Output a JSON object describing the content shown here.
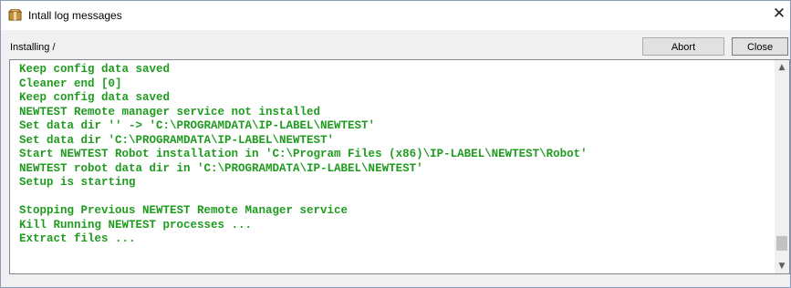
{
  "window": {
    "title": "Intall log messages",
    "icon": "installer-box-icon",
    "close_glyph": "✕"
  },
  "status": {
    "text": "Installing /"
  },
  "buttons": {
    "abort_label": "Abort",
    "close_label": "Close"
  },
  "log": {
    "text_color": "#1f9b1f",
    "lines": [
      "Keep config data saved",
      "Cleaner end [0]",
      "Keep config data saved",
      "NEWTEST Remote manager service not installed",
      "Set data dir '' -> 'C:\\PROGRAMDATA\\IP-LABEL\\NEWTEST'",
      "Set data dir 'C:\\PROGRAMDATA\\IP-LABEL\\NEWTEST'",
      "Start NEWTEST Robot installation in 'C:\\Program Files (x86)\\IP-LABEL\\NEWTEST\\Robot'",
      "NEWTEST robot data dir in 'C:\\PROGRAMDATA\\IP-LABEL\\NEWTEST'",
      "Setup is starting",
      "",
      "Stopping Previous NEWTEST Remote Manager service",
      "Kill Running NEWTEST processes ...",
      "Extract files ..."
    ]
  },
  "scrollbar": {
    "up_glyph": "▲",
    "down_glyph": "▼",
    "position": 0.95
  }
}
